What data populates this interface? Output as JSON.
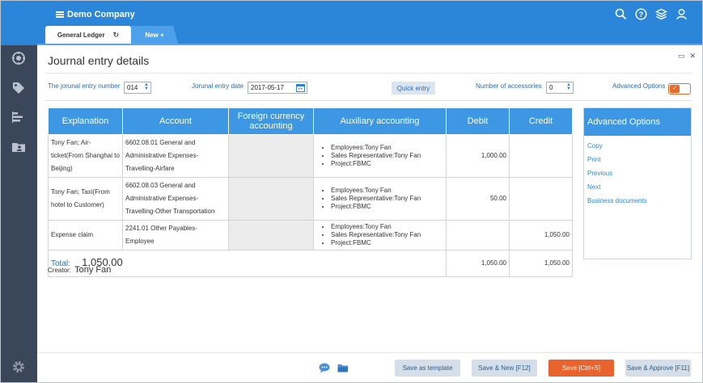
{
  "app": {
    "name": "Demo Company",
    "top_icons": [
      "search-icon",
      "help-icon",
      "layers-icon",
      "user-icon"
    ]
  },
  "tabs": [
    {
      "label": "General Ledger",
      "active": true
    },
    {
      "label": "New +",
      "active": false
    }
  ],
  "sidebar": {
    "icons": [
      "dashboard-icon",
      "tags-icon",
      "chart-bars-icon",
      "folder-person-icon",
      "settings-gear-icon"
    ]
  },
  "page": {
    "title": "Journal entry details"
  },
  "form": {
    "entry_number_label": "The jorunal entry number",
    "entry_number_value": "014",
    "entry_date_label": "Jorunal entry date",
    "entry_date_value": "2017-05-17",
    "quick_entry_label": "Quick entry",
    "accessories_label": "Number of accessories",
    "accessories_value": "0",
    "advanced_options_label": "Advanced Options"
  },
  "table": {
    "headers": {
      "explanation": "Explanation",
      "account": "Account",
      "foreign": "Foreign currency accounting",
      "auxiliary": "Auxiliary accounting",
      "debit": "Debit",
      "credit": "Credit"
    },
    "rows": [
      {
        "explanation": "Tony Fan; Air-ticket(From Shanghai to Beijing)",
        "account": "6602.08.01 General and Administrative Expenses-Travelling-Airfare",
        "aux": [
          "Employees:Tony Fan",
          "Sales Representative:Tony Fan",
          "Project:FBMC"
        ],
        "debit": "1,000.00",
        "credit": ""
      },
      {
        "explanation": "Tony Fan; Taxi(From hotel to Customer)",
        "account": "6602.08.03 General and Administrative Expenses-Travelling-Other Transportation",
        "aux": [
          "Employees:Tony Fan",
          "Sales Representative:Tony Fan",
          "Project:FBMC"
        ],
        "debit": "50.00",
        "credit": ""
      },
      {
        "explanation": "Expense claim",
        "account": "2241.01 Other Payables-Employee",
        "aux": [
          "Employees:Tony Fan",
          "Sales Representative:Tony Fan",
          "Project:FBMC"
        ],
        "debit": "",
        "credit": "1,050.00"
      }
    ],
    "total": {
      "label": "Total:",
      "amount": "1,050.00",
      "debit": "1,050.00",
      "credit": "1,050.00"
    }
  },
  "advanced_panel": {
    "title": "Advanced Options",
    "links": [
      "Copy",
      "Print",
      "Previous",
      "Next",
      "Business documents"
    ]
  },
  "creator": {
    "label": "Creator:",
    "name": "Tony Fan"
  },
  "footer": {
    "icons": [
      "comment-icon",
      "folder-icon"
    ],
    "buttons": {
      "save_template": "Save as template",
      "save_new": "Save & New [F12]",
      "save": "Save [Ctrl+S]",
      "save_approve": "Save & Approve [F11]"
    }
  },
  "colors": {
    "header_blue": "#2b86d9",
    "table_header": "#3d97e2",
    "sidebar": "#3a475a",
    "accent_orange": "#e8632d"
  }
}
